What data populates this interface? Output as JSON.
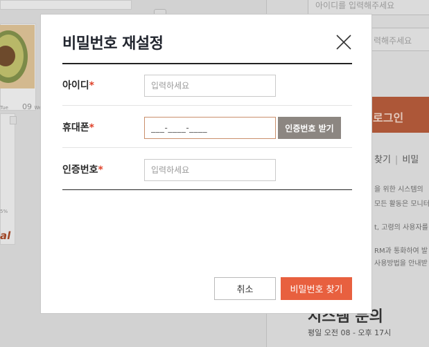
{
  "background": {
    "date_label": "09",
    "day_left": "Tue",
    "day_right": "We",
    "percent_label": "5%",
    "red_text": "al",
    "input_id_placeholder": "아이디를 입력해주세요",
    "input_pw_placeholder": "력해주세요",
    "login_button": "로그인",
    "links": [
      "찾기",
      "비밀"
    ],
    "paragraph_lines": [
      "을 위한 시스템의",
      "모든 활동은 모니터",
      "t, 고령의 사용자를",
      "RM과 통화하여 발",
      "사용방법을 안내받"
    ],
    "inquiry_title": "시스템 문의",
    "hours": "평일 오전 08 - 오후 17시"
  },
  "modal": {
    "title": "비밀번호 재설정",
    "close_icon": "close-icon",
    "fields": {
      "id": {
        "label": "아이디",
        "required_mark": "*",
        "placeholder": "입력하세요",
        "value": ""
      },
      "phone": {
        "label": "휴대폰",
        "required_mark": "*",
        "placeholder": "",
        "value": "___-____-____"
      },
      "code": {
        "label": "인증번호",
        "required_mark": "*",
        "placeholder": "입력하세요",
        "value": ""
      }
    },
    "auth_button": "인증번호 받기",
    "cancel_button": "취소",
    "submit_button": "비밀번호 찾기"
  },
  "colors": {
    "accent": "#e8603f",
    "required": "#e0432b",
    "auth_button": "#8c8681"
  }
}
